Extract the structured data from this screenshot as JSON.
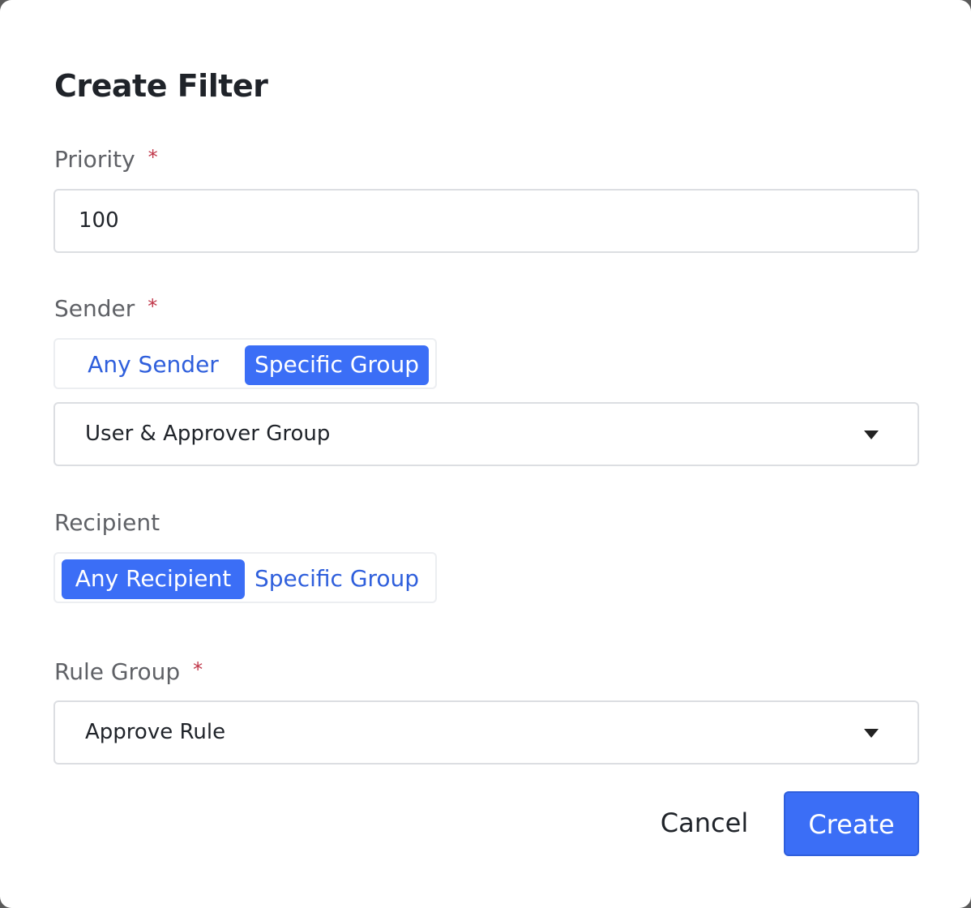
{
  "dialog": {
    "title": "Create Filter"
  },
  "priority": {
    "label": "Priority",
    "required_mark": "*",
    "value": "100"
  },
  "sender": {
    "label": "Sender",
    "required_mark": "*",
    "options": [
      "Any Sender",
      "Specific Group"
    ],
    "selected": "Specific Group",
    "group_value": "User & Approver Group"
  },
  "recipient": {
    "label": "Recipient",
    "options": [
      "Any Recipient",
      "Specific Group"
    ],
    "selected": "Any Recipient"
  },
  "rule_group": {
    "label": "Rule Group",
    "required_mark": "*",
    "value": "Approve Rule"
  },
  "footer": {
    "cancel_label": "Cancel",
    "create_label": "Create"
  },
  "colors": {
    "accent": "#3b6ef6",
    "accent_text": "#2f5fdc",
    "required": "#c03548"
  },
  "icons": {
    "dropdown": "caret-down-icon"
  }
}
